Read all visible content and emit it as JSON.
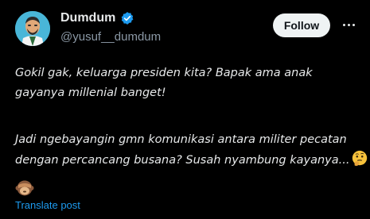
{
  "tweet": {
    "author_name": "Dumdum",
    "handle": "@yusuf__dumdum",
    "follow_label": "Follow",
    "paragraph1": [
      "Gokil gak, keluarga presiden kita? Bapak ama anak",
      "gayanya millenial banget!"
    ],
    "paragraph2": [
      "Jadi ngebayangin gmn komunikasi antara militer pecatan",
      "dengan percancang busana? Susah nyambung kayanya..."
    ],
    "translate_label": "Translate post"
  },
  "icons": {
    "verified": "verified-badge-icon",
    "more": "more-options-icon",
    "thinking": "thinking-face-emoji",
    "monkey": "see-no-evil-monkey-emoji"
  },
  "colors": {
    "background": "#000000",
    "text": "#e7e9ea",
    "secondary": "#8b98a5",
    "link": "#1d9bf0",
    "verified": "#1d9bf0",
    "follow_button": "#eff3f4"
  }
}
